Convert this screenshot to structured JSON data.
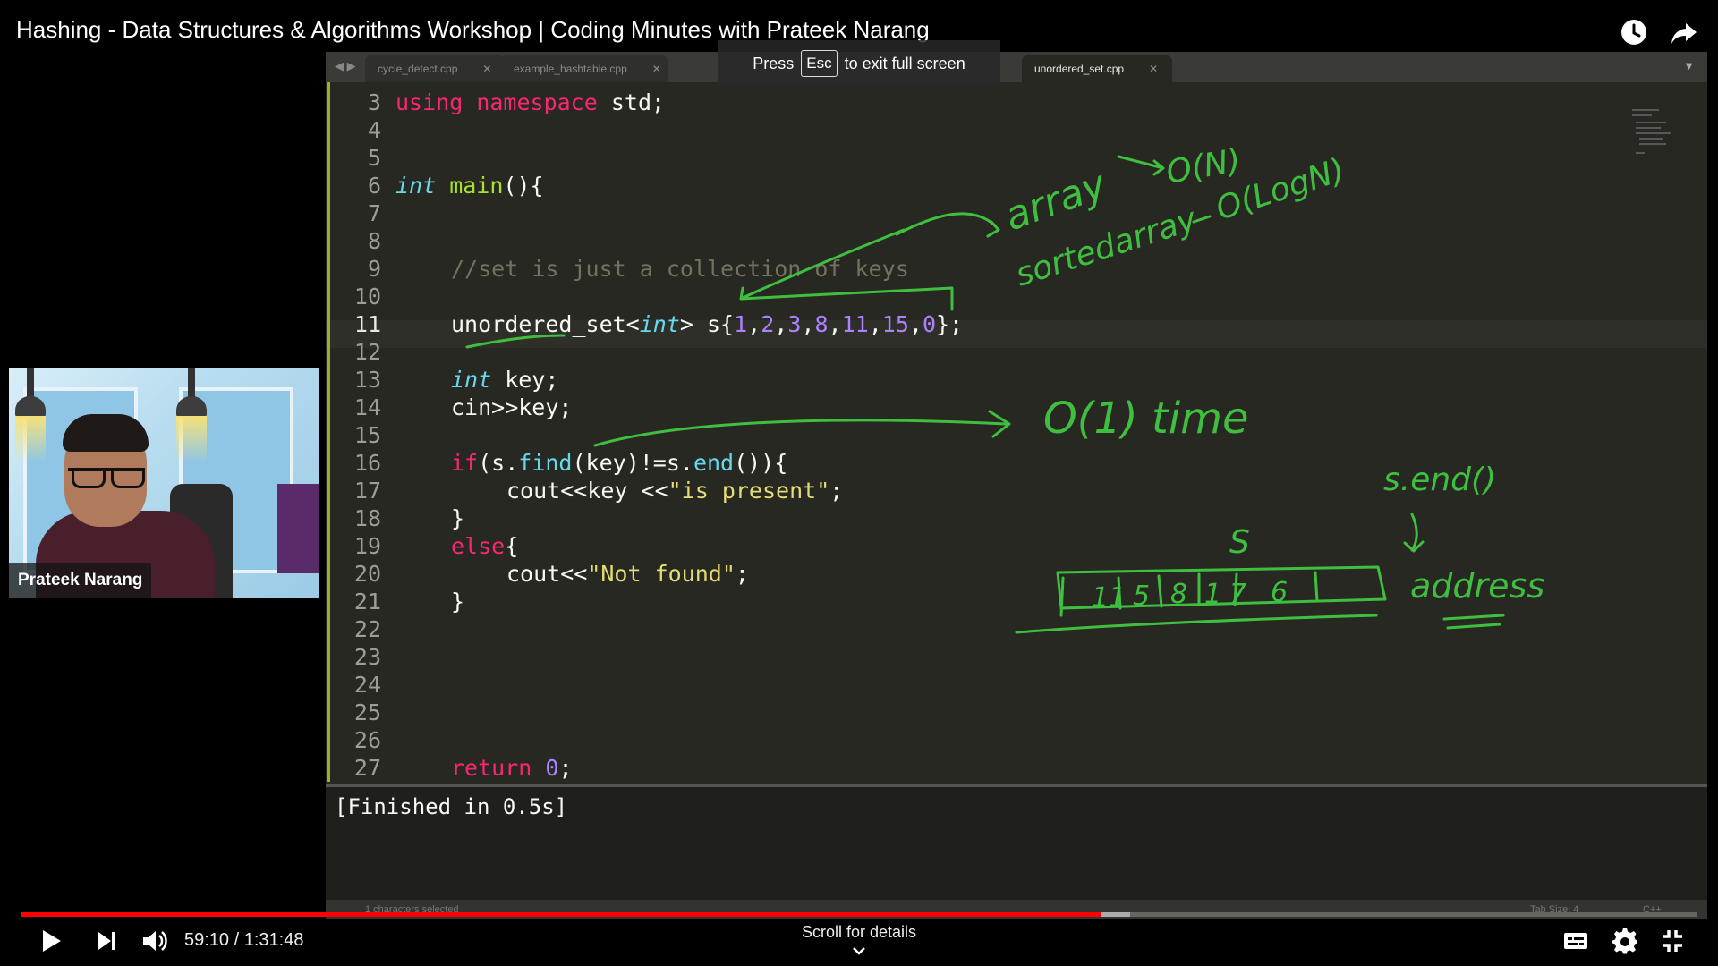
{
  "video": {
    "title": "Hashing - Data Structures & Algorithms Workshop | Coding Minutes with Prateek Narang",
    "presenter": "Prateek Narang"
  },
  "fullscreen_hint": {
    "prefix": "Press",
    "key": "Esc",
    "suffix": "to exit full screen"
  },
  "editor": {
    "tabs": [
      {
        "label": "cycle_detect.cpp",
        "active": false
      },
      {
        "label": "example_hashtable.cpp",
        "active": false
      },
      {
        "label": "unordered_set.cpp",
        "active": true
      }
    ],
    "line_numbers": [
      "3",
      "4",
      "5",
      "6",
      "7",
      "8",
      "9",
      "10",
      "11",
      "12",
      "13",
      "14",
      "15",
      "16",
      "17",
      "18",
      "19",
      "20",
      "21",
      "22",
      "23",
      "24",
      "25",
      "26",
      "27"
    ],
    "current_line": "11",
    "code": {
      "l3_kw1": "using",
      "l3_kw2": "namespace",
      "l3_rest": " std;",
      "l6_type": "int",
      "l6_fn": " main",
      "l6_rest": "(){",
      "l9_comment": "//set is just a collection of keys",
      "l11_a": "unordered_set<",
      "l11_type": "int",
      "l11_b": "> s{",
      "l11_n1": "1",
      "l11_n2": "2",
      "l11_n3": "3",
      "l11_n4": "8",
      "l11_n5": "11",
      "l11_n6": "15",
      "l11_n7": "0",
      "l11_end": "};",
      "l13_type": "int",
      "l13_rest": " key;",
      "l14": "cin>>key;",
      "l16_kw": "if",
      "l16_a": "(s.",
      "l16_fn1": "find",
      "l16_b": "(key)!=s.",
      "l16_fn2": "end",
      "l16_c": "()){",
      "l17_a": "cout<<key <<",
      "l17_str": "\"is present\"",
      "l17_end": ";",
      "l18": "}",
      "l19_kw": "else",
      "l19_rest": "{",
      "l20_a": "cout<<",
      "l20_str": "\"Not found\"",
      "l20_end": ";",
      "l21": "}",
      "l26_kw": "return",
      "l26_num": "0",
      "l26_end": ";",
      "l27": "}"
    },
    "console_output": "[Finished in 0.5s]",
    "status_left": "1 characters selected",
    "status_tab_size": "Tab Size: 4",
    "status_lang": "C++"
  },
  "annotations": {
    "array": "array",
    "array_complexity": "O(N)",
    "sorted_array": "sortedarray",
    "sorted_complexity": "O(LogN)",
    "find_complexity": "O(1) time",
    "s_end": "s.end()",
    "set_name": "S",
    "bucket_values": [
      "11",
      "5",
      "8",
      "1",
      "7",
      "6"
    ],
    "address": "address",
    "color": "#3fbf3f"
  },
  "player": {
    "current_time": "59:10",
    "duration": "1:31:48",
    "time_display": "59:10 / 1:31:48",
    "played_fraction": 0.644,
    "buffered_fraction": 0.662,
    "scroll_hint": "Scroll for details",
    "accent_color": "#ff0000"
  }
}
